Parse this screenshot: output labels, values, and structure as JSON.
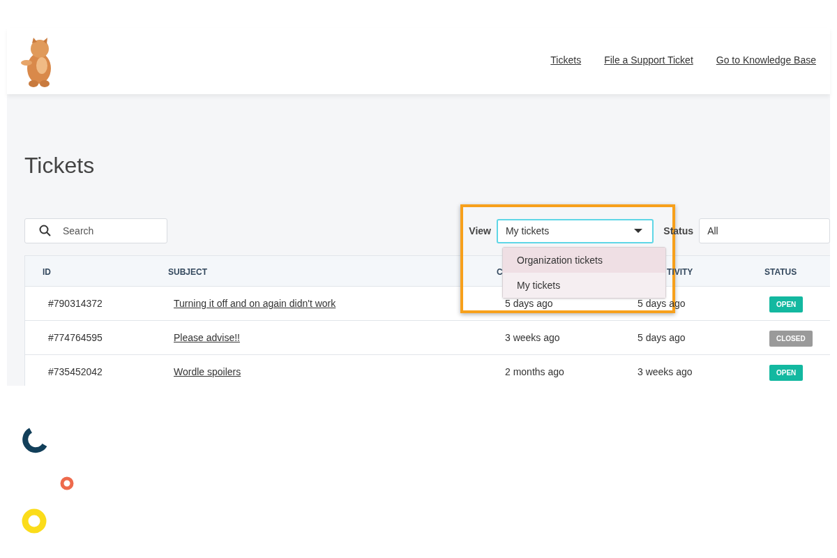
{
  "nav": {
    "links": [
      "Tickets",
      "File a Support Ticket",
      "Go to Knowledge Base"
    ]
  },
  "page": {
    "title": "Tickets"
  },
  "search": {
    "placeholder": "Search"
  },
  "view_filter": {
    "label": "View",
    "value": "My tickets",
    "focused": true,
    "options": [
      {
        "label": "Organization tickets",
        "selected": false
      },
      {
        "label": "My tickets",
        "selected": true
      }
    ]
  },
  "status_filter": {
    "label": "Status",
    "value": "All"
  },
  "table": {
    "columns": [
      "ID",
      "SUBJECT",
      "C",
      "TIVITY",
      "STATUS"
    ],
    "rows": [
      {
        "id": "#790314372",
        "subject": "Turning it off and on again didn't work",
        "created": "5 days ago",
        "activity": "5 days ago",
        "status": {
          "label": "OPEN",
          "kind": "open"
        }
      },
      {
        "id": "#774764595",
        "subject": "Please advise!!",
        "created": "3 weeks ago",
        "activity": "5 days ago",
        "status": {
          "label": "CLOSED",
          "kind": "closed"
        }
      },
      {
        "id": "#735452042",
        "subject": "Wordle spoilers",
        "created": "2 months ago",
        "activity": "3 weeks ago",
        "status": {
          "label": "OPEN",
          "kind": "open"
        }
      }
    ]
  }
}
